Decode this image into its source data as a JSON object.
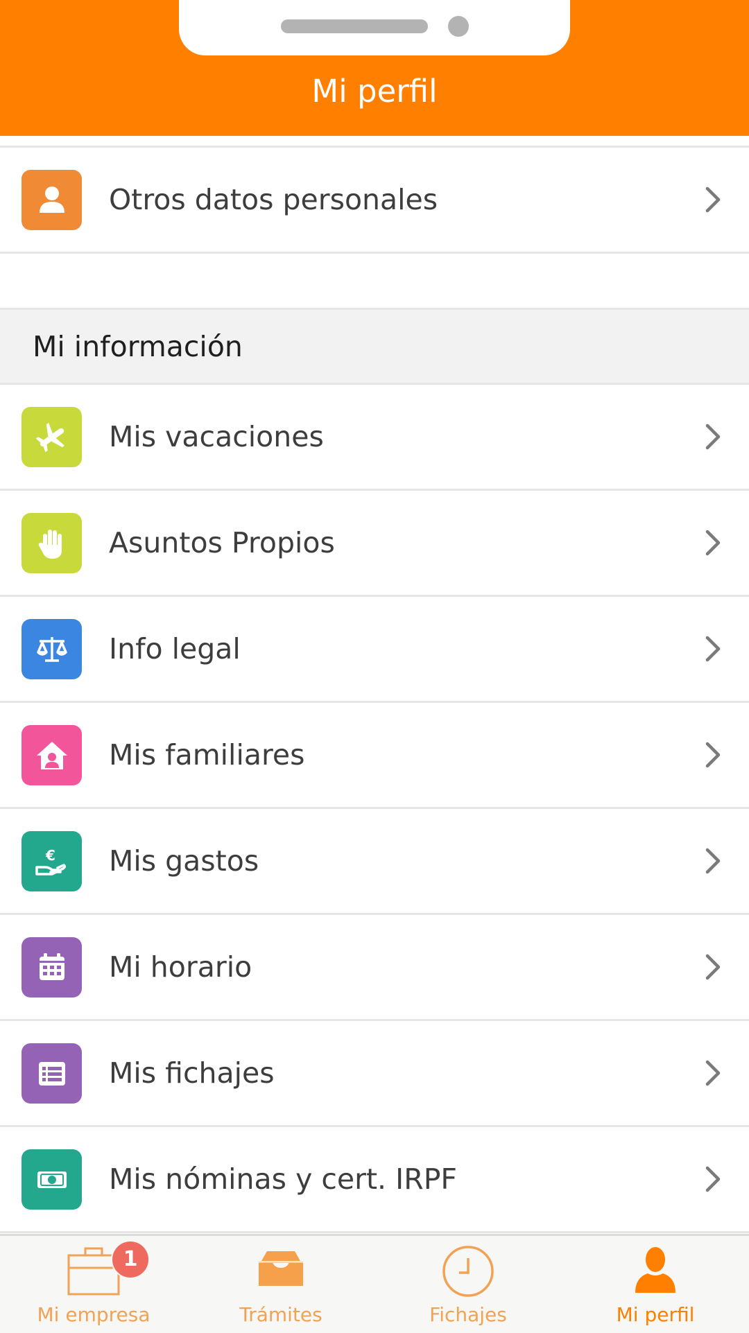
{
  "header": {
    "title": "Mi perfil"
  },
  "top_rows": [
    {
      "label": "Otros datos personales",
      "icon": "person-icon",
      "color": "#f08a35"
    }
  ],
  "section": {
    "title": "Mi información"
  },
  "rows": [
    {
      "label": "Mis vacaciones",
      "icon": "airplane-icon",
      "color": "#c8d93c"
    },
    {
      "label": "Asuntos Propios",
      "icon": "hand-icon",
      "color": "#c8d93c"
    },
    {
      "label": "Info legal",
      "icon": "scales-icon",
      "color": "#3b86e0"
    },
    {
      "label": "Mis familiares",
      "icon": "family-home-icon",
      "color": "#f2559a"
    },
    {
      "label": "Mis gastos",
      "icon": "euro-hand-icon",
      "color": "#23a88e"
    },
    {
      "label": "Mi horario",
      "icon": "calendar-icon",
      "color": "#9563b5"
    },
    {
      "label": "Mis fichajes",
      "icon": "list-icon",
      "color": "#9563b5"
    },
    {
      "label": "Mis nóminas y cert. IRPF",
      "icon": "money-icon",
      "color": "#23a88e"
    }
  ],
  "tabbar": {
    "tabs": [
      {
        "label": "Mi empresa",
        "icon": "briefcase-icon",
        "badge": "1"
      },
      {
        "label": "Trámites",
        "icon": "inbox-tray-icon"
      },
      {
        "label": "Fichajes",
        "icon": "clock-icon"
      },
      {
        "label": "Mi perfil",
        "icon": "profile-icon",
        "active": true
      }
    ]
  },
  "colors": {
    "brand": "#ff7f00",
    "tab_inactive": "#f2a254"
  }
}
